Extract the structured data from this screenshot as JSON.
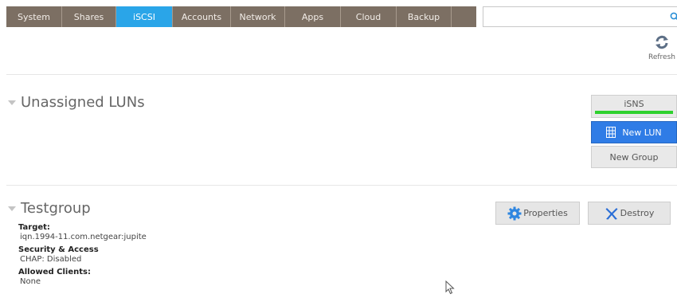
{
  "nav": {
    "tabs": [
      {
        "label": "System"
      },
      {
        "label": "Shares"
      },
      {
        "label": "iSCSI"
      },
      {
        "label": "Accounts"
      },
      {
        "label": "Network"
      },
      {
        "label": "Apps"
      },
      {
        "label": "Cloud"
      },
      {
        "label": "Backup"
      }
    ],
    "active_tab": "iSCSI",
    "search": {
      "value": "",
      "placeholder": ""
    },
    "colors": {
      "tab_bg": "#7c6f63",
      "active_tab_bg": "#2aa5e8"
    }
  },
  "toolbar": {
    "refresh_label": "Refresh"
  },
  "unassigned": {
    "title": "Unassigned LUNs",
    "isns_label": "iSNS",
    "new_lun_label": "New LUN",
    "new_group_label": "New Group"
  },
  "group": {
    "title": "Testgroup",
    "properties_label": "Properties",
    "destroy_label": "Destroy",
    "target_label": "Target:",
    "target_value": "iqn.1994-11.com.netgear:jupite",
    "security_label": "Security & Access",
    "security_value": "CHAP: Disabled",
    "clients_label": "Allowed Clients:",
    "clients_value": "None"
  }
}
